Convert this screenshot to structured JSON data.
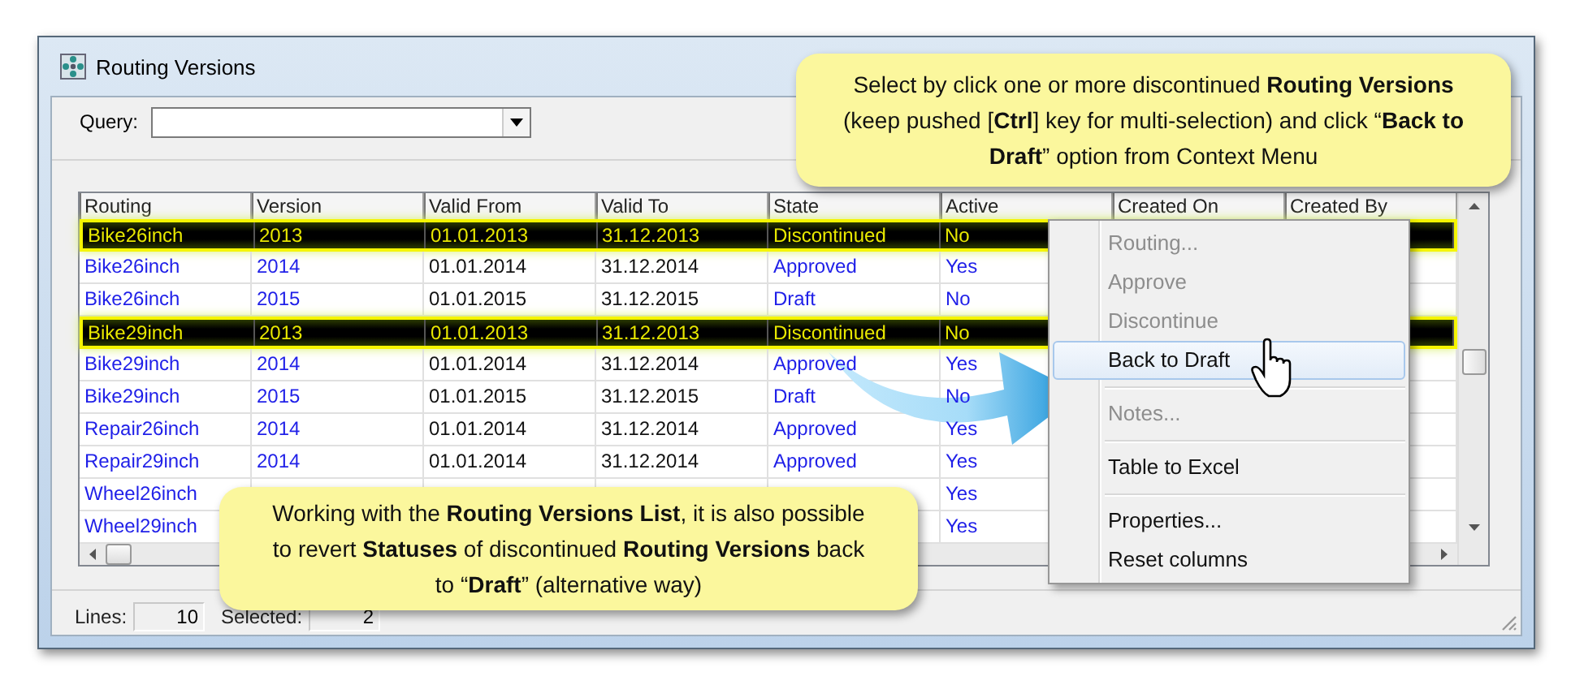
{
  "window": {
    "title": "Routing Versions"
  },
  "query": {
    "label": "Query:"
  },
  "table": {
    "columns": [
      "Routing",
      "Version",
      "Valid From",
      "Valid To",
      "State",
      "Active",
      "Created On",
      "Created By"
    ],
    "rows": [
      {
        "routing": "Bike26inch",
        "version": "2013",
        "valid_from": "01.01.2013",
        "valid_to": "31.12.2013",
        "state": "Discontinued",
        "active": "No",
        "selected": true
      },
      {
        "routing": "Bike26inch",
        "version": "2014",
        "valid_from": "01.01.2014",
        "valid_to": "31.12.2014",
        "state": "Approved",
        "active": "Yes",
        "selected": false
      },
      {
        "routing": "Bike26inch",
        "version": "2015",
        "valid_from": "01.01.2015",
        "valid_to": "31.12.2015",
        "state": "Draft",
        "active": "No",
        "selected": false
      },
      {
        "routing": "Bike29inch",
        "version": "2013",
        "valid_from": "01.01.2013",
        "valid_to": "31.12.2013",
        "state": "Discontinued",
        "active": "No",
        "selected": true
      },
      {
        "routing": "Bike29inch",
        "version": "2014",
        "valid_from": "01.01.2014",
        "valid_to": "31.12.2014",
        "state": "Approved",
        "active": "Yes",
        "selected": false
      },
      {
        "routing": "Bike29inch",
        "version": "2015",
        "valid_from": "01.01.2015",
        "valid_to": "31.12.2015",
        "state": "Draft",
        "active": "No",
        "selected": false
      },
      {
        "routing": "Repair26inch",
        "version": "2014",
        "valid_from": "01.01.2014",
        "valid_to": "31.12.2014",
        "state": "Approved",
        "active": "Yes",
        "selected": false
      },
      {
        "routing": "Repair29inch",
        "version": "2014",
        "valid_from": "01.01.2014",
        "valid_to": "31.12.2014",
        "state": "Approved",
        "active": "Yes",
        "selected": false
      },
      {
        "routing": "Wheel26inch",
        "active": "Yes",
        "selected": false
      },
      {
        "routing": "Wheel29inch",
        "active": "Yes",
        "selected": false
      }
    ]
  },
  "status_bar": {
    "lines_label": "Lines:",
    "lines": "10",
    "selected_label": "Selected:",
    "selected": "2"
  },
  "context_menu": {
    "items": [
      {
        "kind": "item",
        "label": "Routing...",
        "disabled": true,
        "selected": false
      },
      {
        "kind": "item",
        "label": "Approve",
        "disabled": true,
        "selected": false
      },
      {
        "kind": "item",
        "label": "Discontinue",
        "disabled": true,
        "selected": false
      },
      {
        "kind": "item",
        "label": "Back to Draft",
        "disabled": false,
        "selected": true
      },
      {
        "kind": "separator"
      },
      {
        "kind": "item",
        "label": "Notes...",
        "disabled": true,
        "selected": false
      },
      {
        "kind": "separator"
      },
      {
        "kind": "item",
        "label": "Table to Excel",
        "disabled": false,
        "selected": false
      },
      {
        "kind": "separator"
      },
      {
        "kind": "item",
        "label": "Properties...",
        "disabled": false,
        "selected": false
      },
      {
        "kind": "item",
        "label": "Reset columns",
        "disabled": false,
        "selected": false
      }
    ]
  },
  "callouts": [
    {
      "text": "Select by click one or more discontinued **Routing Versions** (keep pushed [**Ctrl**] key for multi-selection) and click “**Back to Draft**” option from Context Menu"
    },
    {
      "text": "Working with the **Routing Versions List**, it is also possible to revert **Statuses** of discontinued **Routing Versions** back to “**Draft**” (alternative way)"
    }
  ]
}
